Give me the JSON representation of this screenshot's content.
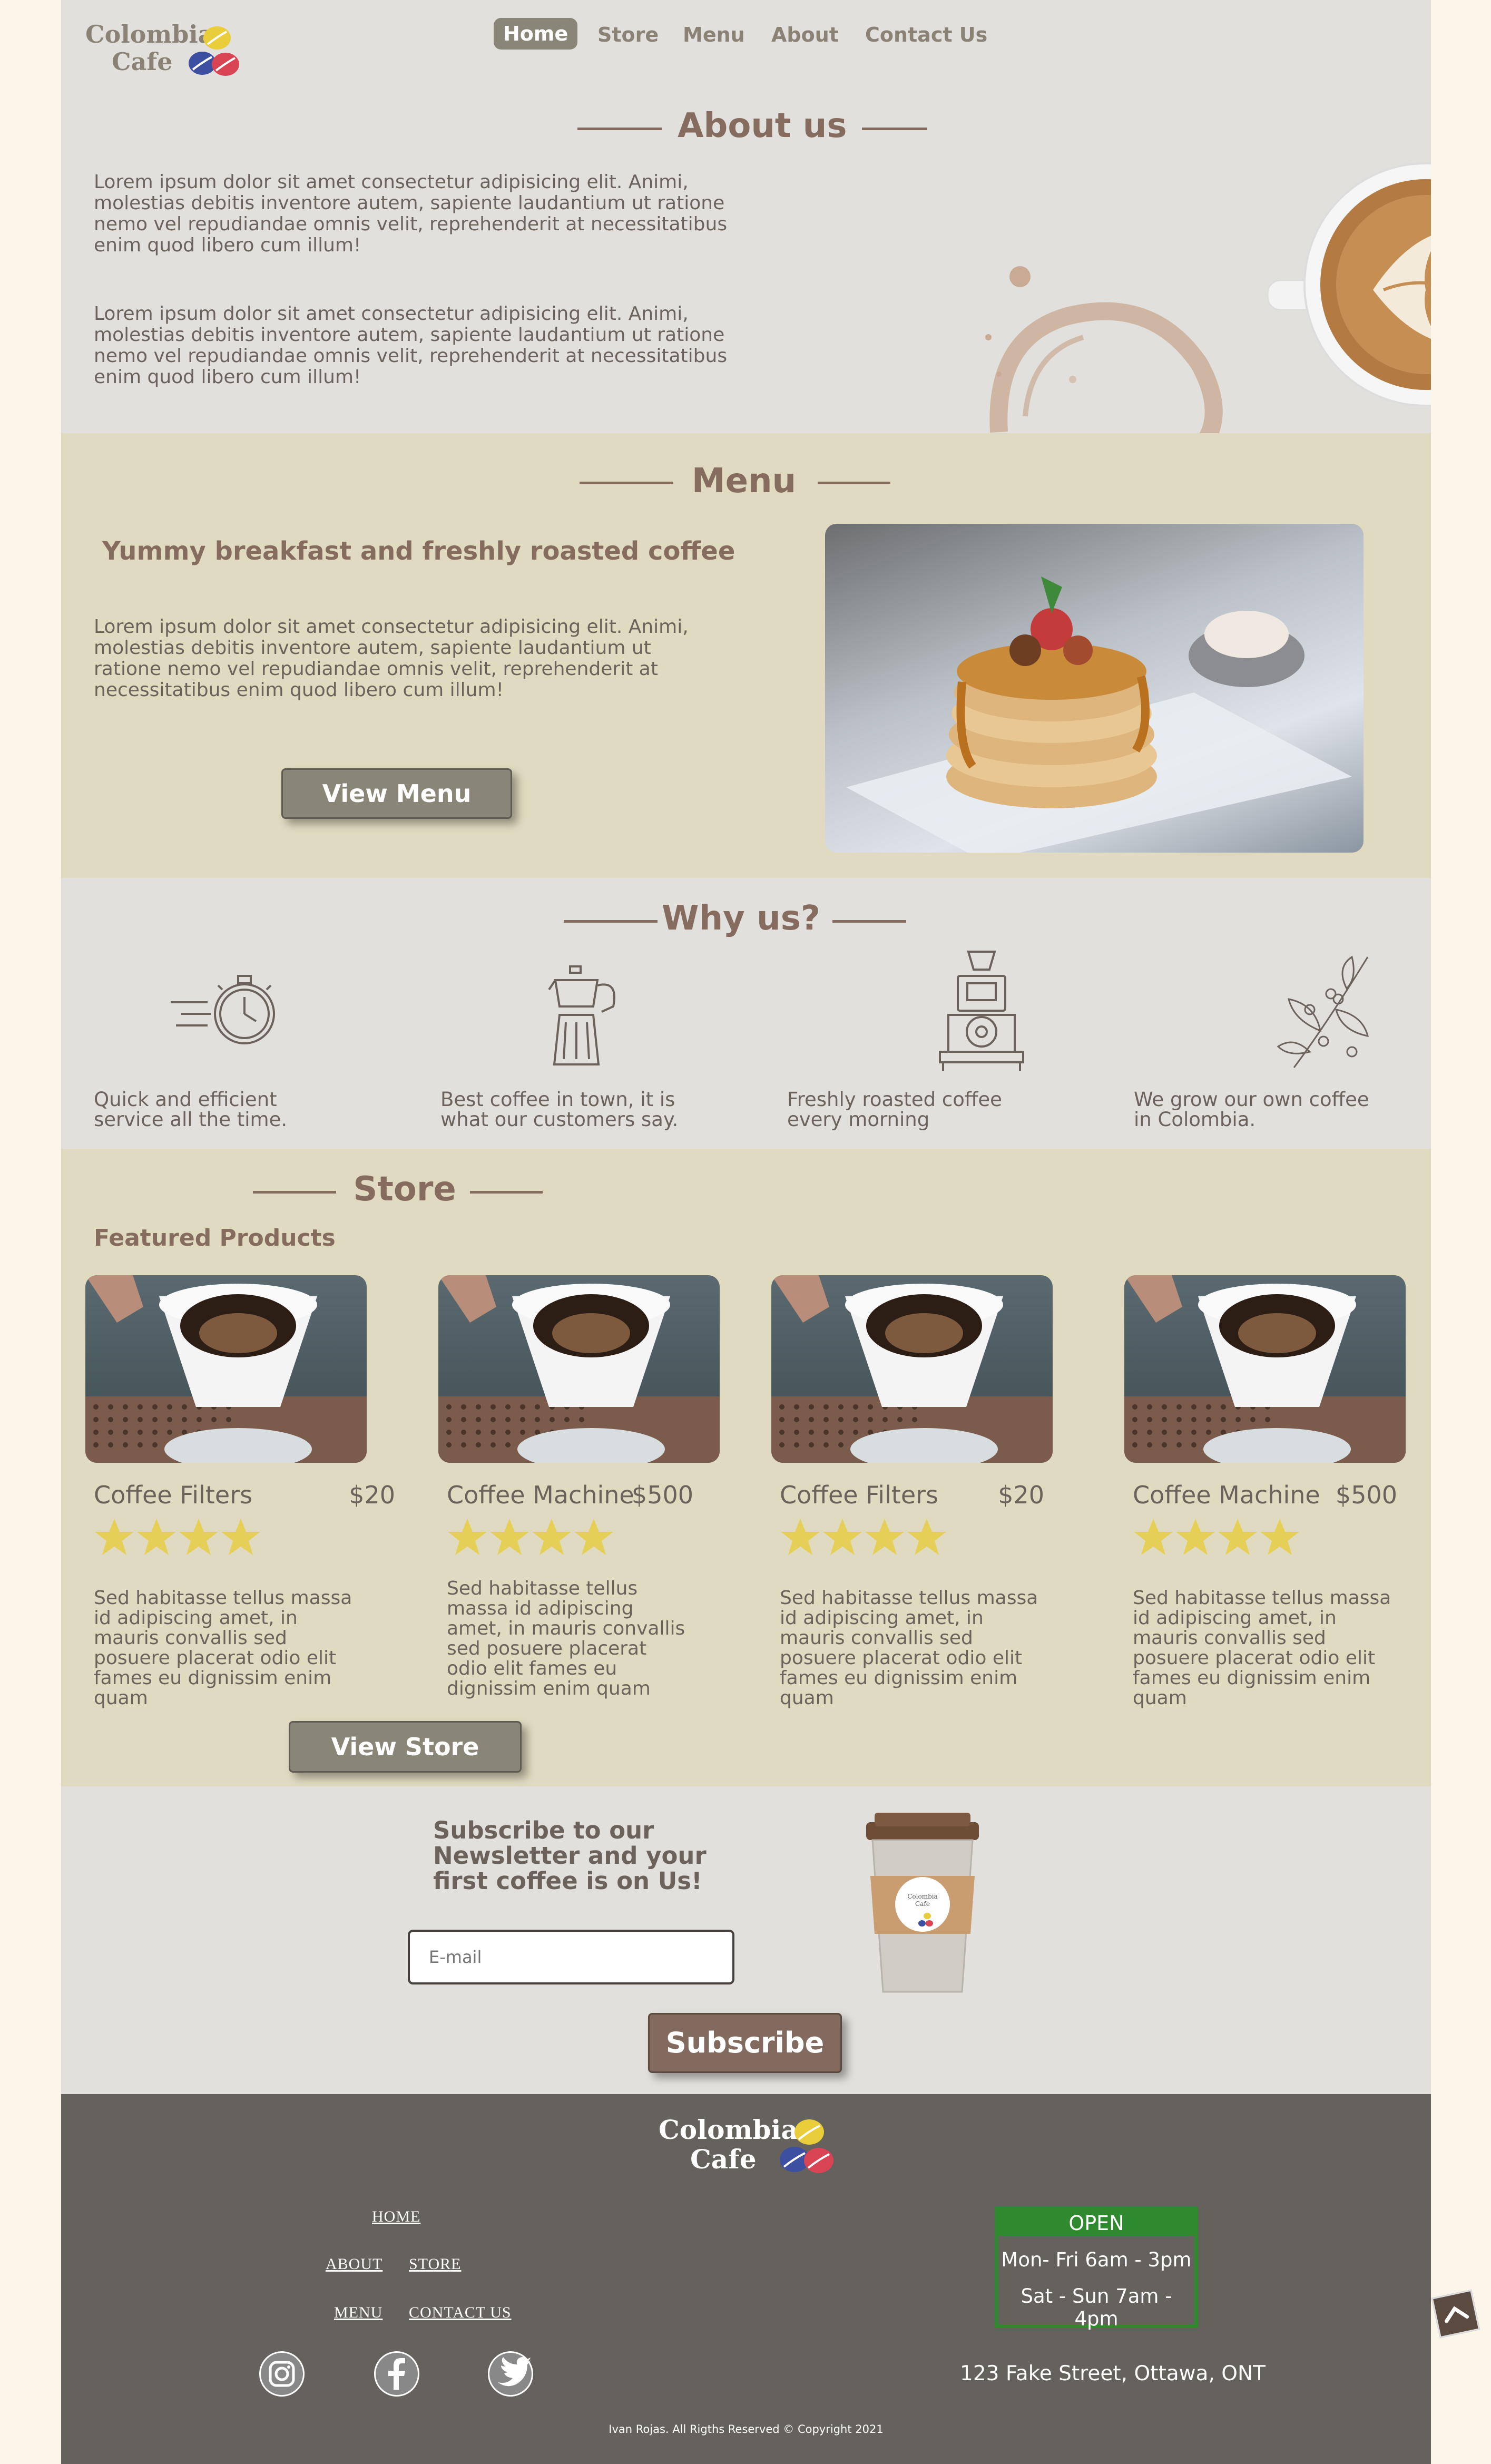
{
  "colors": {
    "accent": "#866c5e",
    "button": "#8a8677",
    "section_gray": "#e2e0dc",
    "section_tan": "#e0dbc0",
    "footer": "#65615c",
    "open_green": "#2f8a2f",
    "star": "#e6cf57"
  },
  "brand": {
    "line1": "Colombia",
    "line2": "Cafe"
  },
  "nav": {
    "items": [
      {
        "label": "Home",
        "active": true
      },
      {
        "label": "Store"
      },
      {
        "label": "Menu"
      },
      {
        "label": "About"
      },
      {
        "label": "Contact Us"
      }
    ]
  },
  "about": {
    "heading": "About us",
    "p1": "Lorem ipsum dolor sit amet consectetur adipisicing elit. Animi, molestias debitis inventore autem, sapiente laudantium ut ratione nemo vel repudiandae omnis velit, reprehenderit at necessitatibus enim quod libero cum illum!",
    "p2": "Lorem ipsum dolor sit amet consectetur adipisicing elit. Animi, molestias debitis inventore autem, sapiente laudantium ut ratione nemo vel repudiandae omnis velit, reprehenderit at necessitatibus enim quod libero cum illum!"
  },
  "menu": {
    "heading": "Menu",
    "subheading": "Yummy breakfast and freshly roasted coffee",
    "text": "Lorem ipsum dolor sit amet consectetur adipisicing elit. Animi, molestias debitis inventore autem, sapiente laudantium ut ratione nemo vel repudiandae omnis velit, reprehenderit at necessitatibus enim quod libero cum illum!",
    "button": "View Menu"
  },
  "why": {
    "heading": "Why us?",
    "items": [
      {
        "icon": "stopwatch-icon",
        "text": "Quick and efficient service all the time."
      },
      {
        "icon": "moka-pot-icon",
        "text": "Best coffee in town, it is what our customers say."
      },
      {
        "icon": "coffee-roaster-icon",
        "text": "Freshly roasted coffee every morning"
      },
      {
        "icon": "coffee-plant-icon",
        "text": "We grow our own coffee in Colombia."
      }
    ]
  },
  "store": {
    "heading": "Store",
    "subheading": "Featured Products",
    "rating": 4,
    "products": [
      {
        "name": "Coffee Filters",
        "price": "$20",
        "desc": "Sed habitasse tellus massa id adipiscing amet, in mauris convallis sed posuere placerat odio elit fames eu dignissim enim quam"
      },
      {
        "name": "Coffee Machine",
        "price": "$500",
        "desc": "Sed habitasse tellus massa id adipiscing amet, in mauris convallis sed posuere placerat odio elit fames eu dignissim enim quam"
      },
      {
        "name": "Coffee Filters",
        "price": "$20",
        "desc": "Sed habitasse tellus massa id adipiscing amet, in mauris convallis sed posuere placerat odio elit fames eu dignissim enim quam"
      },
      {
        "name": "Coffee Machine",
        "price": "$500",
        "desc": "Sed habitasse tellus massa id adipiscing amet, in mauris convallis sed posuere placerat odio elit fames eu dignissim enim quam"
      }
    ],
    "button": "View Store"
  },
  "newsletter": {
    "title": "Subscribe to our Newsletter and your first coffee is on Us!",
    "placeholder": "E-mail",
    "button": "Subscribe",
    "cup_label_1": "Colombia",
    "cup_label_2": "Cafe"
  },
  "footer": {
    "links": {
      "home": "HOME",
      "about": "ABOUT",
      "store": "STORE",
      "menu": "MENU",
      "contact": "CONTACT US"
    },
    "hours": {
      "title": "OPEN",
      "weekday": "Mon- Fri 6am - 3pm",
      "weekend": "Sat - Sun 7am - 4pm"
    },
    "address": "123 Fake Street, Ottawa, ONT",
    "copyright": "Ivan Rojas. All Rigths Reserved © Copyright 2021",
    "social": [
      "instagram-icon",
      "facebook-icon",
      "twitter-icon"
    ]
  }
}
